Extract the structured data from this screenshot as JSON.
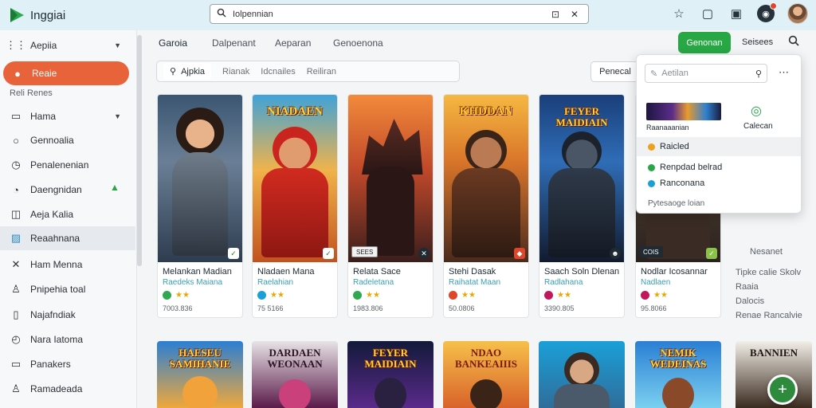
{
  "app": {
    "name": "Inggiai"
  },
  "search": {
    "query": "Iolpennian"
  },
  "nav": {
    "tabs": [
      "Garoia",
      "Dalpenant",
      "Aeparan",
      "Genoenona"
    ],
    "primary_button": "Genonan",
    "secondary_link": "Seisees"
  },
  "sidebar": {
    "items": [
      {
        "label": "Aepiia",
        "icon": "grid-icon"
      },
      {
        "label": "Reaie",
        "icon": "home-icon"
      },
      {
        "label": "Hama",
        "icon": "window-icon"
      },
      {
        "label": "Gennoalia",
        "icon": "circle-icon"
      },
      {
        "label": "Penalenenian",
        "icon": "circle-icon"
      },
      {
        "label": "Daengnidan",
        "icon": "circle-icon"
      },
      {
        "label": "Aeja Kalia",
        "icon": "bag-icon"
      },
      {
        "label": "Reaahnana",
        "icon": "image-icon"
      },
      {
        "label": "Ham Menna",
        "icon": "cross-icon"
      },
      {
        "label": "Pnipehia toal",
        "icon": "person-icon"
      },
      {
        "label": "Najafndiak",
        "icon": "box-icon"
      },
      {
        "label": "Nara Iatoma",
        "icon": "clock-icon"
      },
      {
        "label": "Panakers",
        "icon": "window-icon"
      },
      {
        "label": "Ramadeada",
        "icon": "person-icon"
      }
    ],
    "section_label": "Reli Renes"
  },
  "filters": {
    "active": "Ajpkia",
    "options": [
      "Rianak",
      "Idcnailes",
      "Reiliran"
    ]
  },
  "sort": {
    "label": "Penecal"
  },
  "cards": [
    {
      "title": "",
      "name": "Melankan Madian",
      "sub": "Raedeks Maiana",
      "stars": "★★",
      "meta": "7003.836"
    },
    {
      "title": "NIADAEN",
      "name": "Nladaen Mana",
      "sub": "Raelahian",
      "stars": "★★",
      "meta": "75 5166"
    },
    {
      "title": "",
      "name": "Relata Sace",
      "sub": "Radeletana",
      "stars": "★★",
      "meta": "1983.806",
      "tag": "SEES"
    },
    {
      "title": "KHDDAN",
      "name": "Stehi Dasak",
      "sub": "Raihatat Maan",
      "stars": "★★",
      "meta": "50.0806"
    },
    {
      "title": "FEYER MAIDIAIN",
      "name": "Saach Soln Dlenan",
      "sub": "Radlahana",
      "stars": "★★",
      "meta": "3390.805"
    },
    {
      "title": "",
      "name": "Nodlar Icosannar",
      "sub": "Nadlaen",
      "stars": "★★",
      "meta": "95.8066",
      "tag": "COIS"
    }
  ],
  "row2_titles": [
    "HAESEU SAMIHANIE",
    "DARDAEN WEONAAN",
    "FEYER MAIDIAIN",
    "NDAO BANKEAIIIS",
    "",
    "NEMIK WEDEINAS",
    "BANNIEN"
  ],
  "side_info": {
    "heading": "Nesanet",
    "lines": [
      "Tipke calie Skolv",
      "Raaia",
      "Dalocis",
      "Renae Rancalvie"
    ]
  },
  "popover": {
    "search_placeholder": "Aetilan",
    "thumb_label": "Raanaaanian",
    "app_label": "Calecan",
    "items": [
      {
        "label": "Raicled",
        "color": "#f0a020"
      },
      {
        "label": "Renpdad belrad",
        "color": "#28a745"
      },
      {
        "label": "Ranconana",
        "color": "#1aa0d8"
      }
    ],
    "footer": "Pytesaoge loian"
  }
}
